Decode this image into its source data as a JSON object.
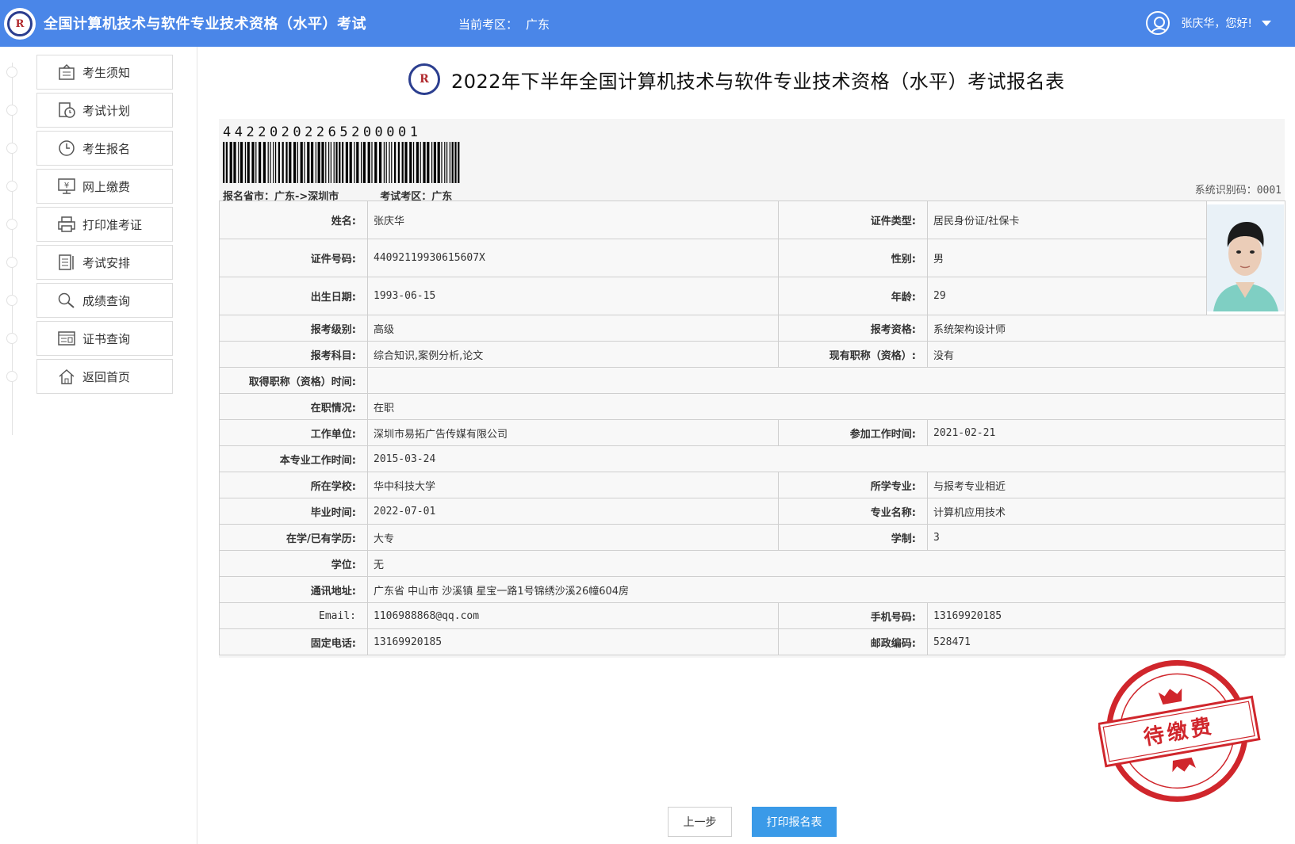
{
  "header": {
    "app_title": "全国计算机技术与软件专业技术资格（水平）考试",
    "region_label": "当前考区：",
    "region_value": "广东",
    "greeting": "张庆华，您好!",
    "bg_color": "#4a86e8"
  },
  "sidebar": {
    "items": [
      {
        "label": "考生须知",
        "icon": "notice-icon"
      },
      {
        "label": "考试计划",
        "icon": "calendar-clock-icon"
      },
      {
        "label": "考生报名",
        "icon": "clock-icon"
      },
      {
        "label": "网上缴费",
        "icon": "payment-monitor-icon"
      },
      {
        "label": "打印准考证",
        "icon": "printer-icon"
      },
      {
        "label": "考试安排",
        "icon": "document-list-icon"
      },
      {
        "label": "成绩查询",
        "icon": "magnifier-icon"
      },
      {
        "label": "证书查询",
        "icon": "certificate-icon"
      },
      {
        "label": "返回首页",
        "icon": "home-icon"
      }
    ]
  },
  "form": {
    "title": "2022年下半年全国计算机技术与软件专业技术资格（水平）考试报名表",
    "barcode_number": "44220202265200001",
    "province_city": "报名省市：广东->深圳市",
    "exam_region": "考试考区：广东",
    "system_id": "系统识别码：0001",
    "stamp_text": "待缴费",
    "stamp_color": "#d0262c"
  },
  "fields": {
    "name_label": "姓名:",
    "name": "张庆华",
    "id_type_label": "证件类型:",
    "id_type": "居民身份证/社保卡",
    "id_no_label": "证件号码:",
    "id_no": "44092119930615607X",
    "gender_label": "性别:",
    "gender": "男",
    "birth_label": "出生日期:",
    "birth": "1993-06-15",
    "age_label": "年龄:",
    "age": "29",
    "level_label": "报考级别:",
    "level": "高级",
    "qual_label": "报考资格:",
    "qual": "系统架构设计师",
    "subjects_label": "报考科目:",
    "subjects": "综合知识,案例分析,论文",
    "title_label": "现有职称（资格）:",
    "title": "没有",
    "title_time_label": "取得职称（资格）时间:",
    "title_time": "",
    "employment_label": "在职情况:",
    "employment": "在职",
    "employer_label": "工作单位:",
    "employer": "深圳市易拓广告传媒有限公司",
    "work_start_label": "参加工作时间:",
    "work_start": "2021-02-21",
    "major_work_label": "本专业工作时间:",
    "major_work": "2015-03-24",
    "school_label": "所在学校:",
    "school": "华中科技大学",
    "major_rel_label": "所学专业:",
    "major_rel": "与报考专业相近",
    "grad_label": "毕业时间:",
    "grad": "2022-07-01",
    "major_name_label": "专业名称:",
    "major_name": "计算机应用技术",
    "edu_label": "在学/已有学历:",
    "edu": "大专",
    "duration_label": "学制:",
    "duration": "3",
    "degree_label": "学位:",
    "degree": "无",
    "address_label": "通讯地址:",
    "address": "广东省 中山市 沙溪镇 星宝一路1号锦绣沙溪26幢604房",
    "email_label": "Email:",
    "email": "1106988868@qq.com",
    "mobile_label": "手机号码:",
    "mobile": "13169920185",
    "phone_label": "固定电话:",
    "phone": "13169920185",
    "postcode_label": "邮政编码:",
    "postcode": "528471"
  },
  "buttons": {
    "prev": "上一步",
    "print": "打印报名表"
  }
}
